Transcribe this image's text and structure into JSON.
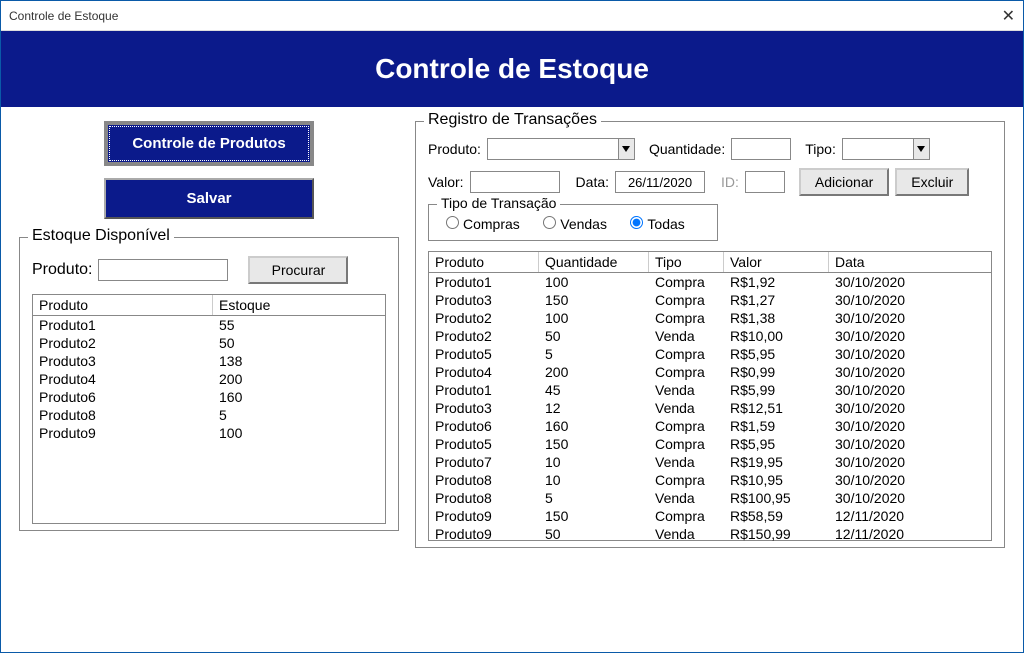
{
  "window": {
    "title": "Controle de Estoque"
  },
  "header": {
    "title": "Controle de Estoque"
  },
  "left": {
    "products_button": "Controle de Produtos",
    "save_button": "Salvar",
    "stock_group_title": "Estoque Disponível",
    "product_label": "Produto:",
    "search_button": "Procurar",
    "columns": [
      "Produto",
      "Estoque"
    ],
    "rows": [
      {
        "produto": "Produto1",
        "estoque": "55"
      },
      {
        "produto": "Produto2",
        "estoque": "50"
      },
      {
        "produto": "Produto3",
        "estoque": "138"
      },
      {
        "produto": "Produto4",
        "estoque": "200"
      },
      {
        "produto": "Produto6",
        "estoque": "160"
      },
      {
        "produto": "Produto8",
        "estoque": "5"
      },
      {
        "produto": "Produto9",
        "estoque": "100"
      }
    ]
  },
  "right": {
    "group_title": "Registro de Transações",
    "product_label": "Produto:",
    "quantity_label": "Quantidade:",
    "type_label": "Tipo:",
    "value_label": "Valor:",
    "date_label": "Data:",
    "date_value": "26/11/2020",
    "id_label": "ID:",
    "add_button": "Adicionar",
    "delete_button": "Excluir",
    "filter": {
      "title": "Tipo de Transação",
      "compras": "Compras",
      "vendas": "Vendas",
      "todas": "Todas",
      "selected": "todas"
    },
    "columns": [
      "Produto",
      "Quantidade",
      "Tipo",
      "Valor",
      "Data"
    ],
    "rows": [
      {
        "produto": "Produto1",
        "quantidade": "100",
        "tipo": "Compra",
        "valor": "R$1,92",
        "data": "30/10/2020"
      },
      {
        "produto": "Produto3",
        "quantidade": "150",
        "tipo": "Compra",
        "valor": "R$1,27",
        "data": "30/10/2020"
      },
      {
        "produto": "Produto2",
        "quantidade": "100",
        "tipo": "Compra",
        "valor": "R$1,38",
        "data": "30/10/2020"
      },
      {
        "produto": "Produto2",
        "quantidade": "50",
        "tipo": "Venda",
        "valor": "R$10,00",
        "data": "30/10/2020"
      },
      {
        "produto": "Produto5",
        "quantidade": "5",
        "tipo": "Compra",
        "valor": "R$5,95",
        "data": "30/10/2020"
      },
      {
        "produto": "Produto4",
        "quantidade": "200",
        "tipo": "Compra",
        "valor": "R$0,99",
        "data": "30/10/2020"
      },
      {
        "produto": "Produto1",
        "quantidade": "45",
        "tipo": "Venda",
        "valor": "R$5,99",
        "data": "30/10/2020"
      },
      {
        "produto": "Produto3",
        "quantidade": "12",
        "tipo": "Venda",
        "valor": "R$12,51",
        "data": "30/10/2020"
      },
      {
        "produto": "Produto6",
        "quantidade": "160",
        "tipo": "Compra",
        "valor": "R$1,59",
        "data": "30/10/2020"
      },
      {
        "produto": "Produto5",
        "quantidade": "150",
        "tipo": "Compra",
        "valor": "R$5,95",
        "data": "30/10/2020"
      },
      {
        "produto": "Produto7",
        "quantidade": "10",
        "tipo": "Venda",
        "valor": "R$19,95",
        "data": "30/10/2020"
      },
      {
        "produto": "Produto8",
        "quantidade": "10",
        "tipo": "Compra",
        "valor": "R$10,95",
        "data": "30/10/2020"
      },
      {
        "produto": "Produto8",
        "quantidade": "5",
        "tipo": "Venda",
        "valor": "R$100,95",
        "data": "30/10/2020"
      },
      {
        "produto": "Produto9",
        "quantidade": "150",
        "tipo": "Compra",
        "valor": "R$58,59",
        "data": "12/11/2020"
      },
      {
        "produto": "Produto9",
        "quantidade": "50",
        "tipo": "Venda",
        "valor": "R$150,99",
        "data": "12/11/2020"
      }
    ]
  }
}
